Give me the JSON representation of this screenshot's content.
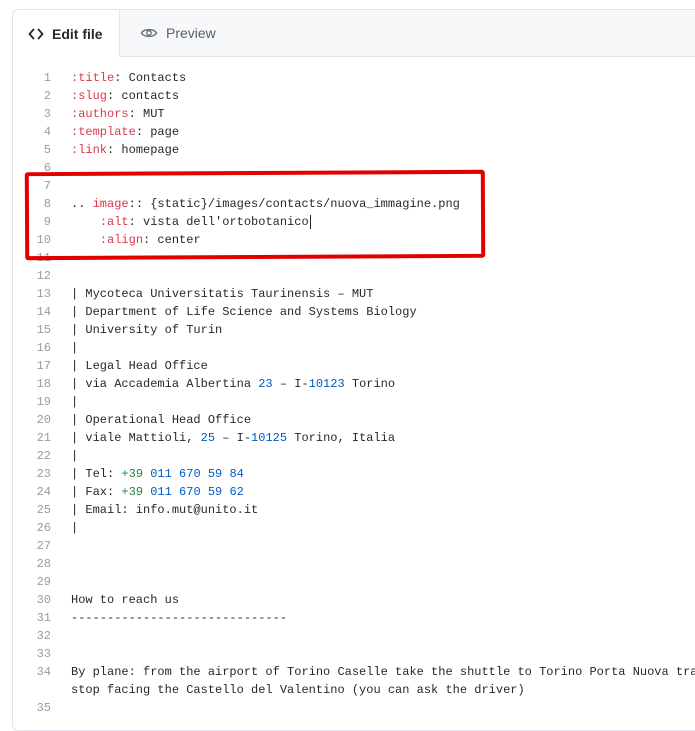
{
  "tabs": {
    "edit_label": "Edit file",
    "preview_label": "Preview"
  },
  "lines": [
    {
      "n": "1",
      "segs": [
        {
          "t": ":title",
          "c": "red"
        },
        {
          "t": ": Contacts"
        }
      ]
    },
    {
      "n": "2",
      "segs": [
        {
          "t": ":slug",
          "c": "red"
        },
        {
          "t": ": contacts"
        }
      ]
    },
    {
      "n": "3",
      "segs": [
        {
          "t": ":authors",
          "c": "red"
        },
        {
          "t": ": MUT"
        }
      ]
    },
    {
      "n": "4",
      "segs": [
        {
          "t": ":template",
          "c": "red"
        },
        {
          "t": ": page"
        }
      ]
    },
    {
      "n": "5",
      "segs": [
        {
          "t": ":link",
          "c": "red"
        },
        {
          "t": ": homepage"
        }
      ]
    },
    {
      "n": "6",
      "segs": []
    },
    {
      "n": "7",
      "segs": []
    },
    {
      "n": "8",
      "segs": [
        {
          "t": ".. "
        },
        {
          "t": "image",
          "c": "red"
        },
        {
          "t": ":: {static}/images/contacts/nuova_immagine.png"
        }
      ]
    },
    {
      "n": "9",
      "segs": [
        {
          "t": "    "
        },
        {
          "t": ":alt",
          "c": "red"
        },
        {
          "t": ": vista dell'ortobotanico"
        }
      ],
      "cursor": true
    },
    {
      "n": "10",
      "segs": [
        {
          "t": "    "
        },
        {
          "t": ":align",
          "c": "red"
        },
        {
          "t": ": center"
        }
      ]
    },
    {
      "n": "11",
      "segs": []
    },
    {
      "n": "12",
      "segs": []
    },
    {
      "n": "13",
      "segs": [
        {
          "t": "| Mycoteca Universitatis Taurinensis – MUT"
        }
      ]
    },
    {
      "n": "14",
      "segs": [
        {
          "t": "| Department of Life Science and Systems Biology"
        }
      ]
    },
    {
      "n": "15",
      "segs": [
        {
          "t": "| University of Turin"
        }
      ]
    },
    {
      "n": "16",
      "segs": [
        {
          "t": "|"
        }
      ]
    },
    {
      "n": "17",
      "segs": [
        {
          "t": "| Legal Head Office"
        }
      ]
    },
    {
      "n": "18",
      "segs": [
        {
          "t": "| via Accademia Albertina "
        },
        {
          "t": "23",
          "c": "blue"
        },
        {
          "t": " – I-"
        },
        {
          "t": "10123",
          "c": "blue"
        },
        {
          "t": " Torino"
        }
      ]
    },
    {
      "n": "19",
      "segs": [
        {
          "t": "|"
        }
      ]
    },
    {
      "n": "20",
      "segs": [
        {
          "t": "| Operational Head Office"
        }
      ]
    },
    {
      "n": "21",
      "segs": [
        {
          "t": "| viale Mattioli, "
        },
        {
          "t": "25",
          "c": "blue"
        },
        {
          "t": " – I-"
        },
        {
          "t": "10125",
          "c": "blue"
        },
        {
          "t": " Torino, Italia"
        }
      ]
    },
    {
      "n": "22",
      "segs": [
        {
          "t": "|"
        }
      ]
    },
    {
      "n": "23",
      "segs": [
        {
          "t": "| Tel: "
        },
        {
          "t": "+39",
          "c": "green"
        },
        {
          "t": " "
        },
        {
          "t": "011 670 59 84",
          "c": "blue"
        }
      ]
    },
    {
      "n": "24",
      "segs": [
        {
          "t": "| Fax: "
        },
        {
          "t": "+39",
          "c": "green"
        },
        {
          "t": " "
        },
        {
          "t": "011 670 59 62",
          "c": "blue"
        }
      ]
    },
    {
      "n": "25",
      "segs": [
        {
          "t": "| Email: info.mut@unito.it"
        }
      ]
    },
    {
      "n": "26",
      "segs": [
        {
          "t": "|"
        }
      ]
    },
    {
      "n": "27",
      "segs": []
    },
    {
      "n": "28",
      "segs": []
    },
    {
      "n": "29",
      "segs": []
    },
    {
      "n": "30",
      "segs": [
        {
          "t": "How to reach us"
        }
      ]
    },
    {
      "n": "31",
      "segs": [
        {
          "t": "------------------------------"
        }
      ]
    },
    {
      "n": "32",
      "segs": []
    },
    {
      "n": "33",
      "segs": []
    },
    {
      "n": "34",
      "segs": [
        {
          "t": "By plane: from the airport of Torino Caselle take the shuttle to Torino Porta Nuova train station and"
        }
      ]
    },
    {
      "n": "",
      "segs": [
        {
          "t": "stop facing the Castello del Valentino (you can ask the driver)"
        }
      ]
    },
    {
      "n": "35",
      "segs": []
    }
  ]
}
